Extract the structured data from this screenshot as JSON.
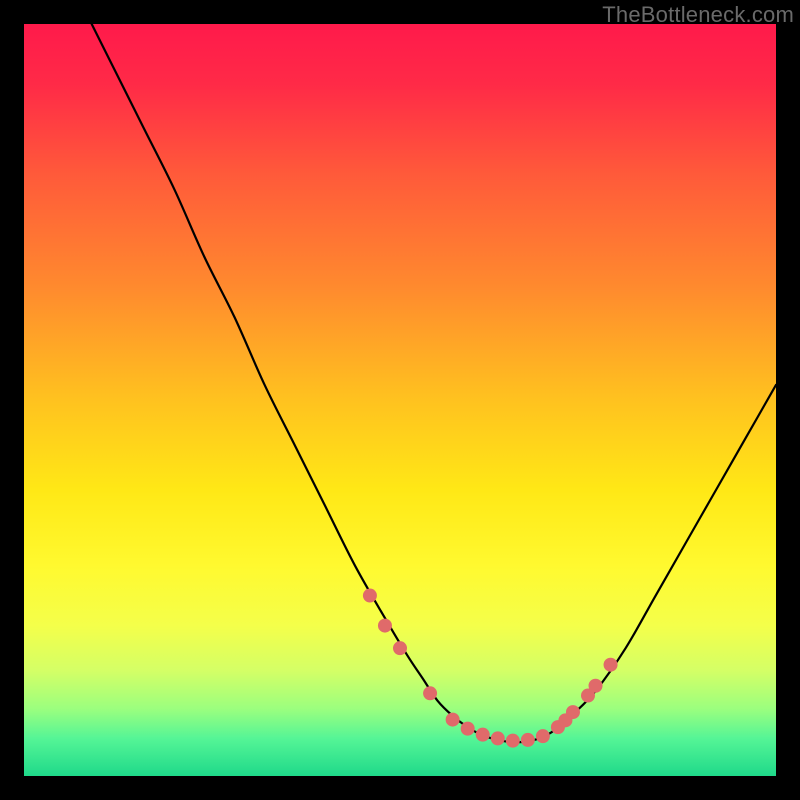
{
  "watermark": "TheBottleneck.com",
  "gradient": {
    "stops": [
      {
        "offset": 0.0,
        "color": "#ff1a4b"
      },
      {
        "offset": 0.08,
        "color": "#ff2a47"
      },
      {
        "offset": 0.2,
        "color": "#ff5a3a"
      },
      {
        "offset": 0.35,
        "color": "#ff8a2e"
      },
      {
        "offset": 0.5,
        "color": "#ffc21f"
      },
      {
        "offset": 0.62,
        "color": "#ffe816"
      },
      {
        "offset": 0.72,
        "color": "#fff92f"
      },
      {
        "offset": 0.8,
        "color": "#f4ff4a"
      },
      {
        "offset": 0.86,
        "color": "#d4ff66"
      },
      {
        "offset": 0.91,
        "color": "#9cff7e"
      },
      {
        "offset": 0.95,
        "color": "#55f596"
      },
      {
        "offset": 1.0,
        "color": "#1fd98a"
      }
    ]
  },
  "chart_data": {
    "type": "line",
    "title": "",
    "xlabel": "",
    "ylabel": "",
    "xlim": [
      0,
      100
    ],
    "ylim": [
      0,
      100
    ],
    "series": [
      {
        "name": "curve",
        "x": [
          9,
          12,
          16,
          20,
          24,
          28,
          32,
          36,
          40,
          44,
          48,
          51,
          53,
          55,
          57,
          59,
          61,
          63,
          65,
          67,
          69,
          71,
          73,
          76,
          80,
          84,
          88,
          92,
          96,
          100
        ],
        "y": [
          100,
          94,
          86,
          78,
          69,
          61,
          52,
          44,
          36,
          28,
          21,
          16,
          13,
          10,
          8,
          6.5,
          5.4,
          4.8,
          4.5,
          4.6,
          5.2,
          6.4,
          8.2,
          11.3,
          17,
          24,
          31,
          38,
          45,
          52
        ]
      }
    ],
    "markers": {
      "name": "dots",
      "color": "#e06a6a",
      "radius": 7,
      "x": [
        46,
        48,
        50,
        54,
        57,
        59,
        61,
        63,
        65,
        67,
        69,
        71,
        72,
        73,
        75,
        76,
        78
      ],
      "y": [
        24,
        20,
        17,
        11,
        7.5,
        6.3,
        5.5,
        5.0,
        4.7,
        4.8,
        5.3,
        6.5,
        7.4,
        8.5,
        10.7,
        12.0,
        14.8
      ]
    }
  }
}
